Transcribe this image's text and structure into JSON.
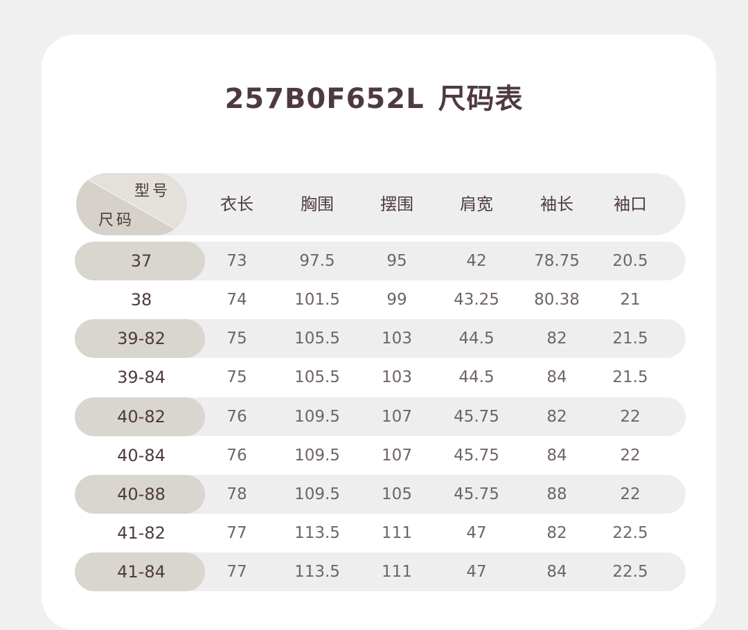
{
  "title": {
    "code": "257B0F652L",
    "label": "尺码表"
  },
  "header": {
    "corner_top": "型号",
    "corner_bottom": "尺码",
    "columns": [
      "衣长",
      "胸围",
      "摆围",
      "肩宽",
      "袖长",
      "袖口"
    ]
  },
  "rows": [
    {
      "size": "37",
      "values": [
        "73",
        "97.5",
        "95",
        "42",
        "78.75",
        "20.5"
      ]
    },
    {
      "size": "38",
      "values": [
        "74",
        "101.5",
        "99",
        "43.25",
        "80.38",
        "21"
      ]
    },
    {
      "size": "39-82",
      "values": [
        "75",
        "105.5",
        "103",
        "44.5",
        "82",
        "21.5"
      ]
    },
    {
      "size": "39-84",
      "values": [
        "75",
        "105.5",
        "103",
        "44.5",
        "84",
        "21.5"
      ]
    },
    {
      "size": "40-82",
      "values": [
        "76",
        "109.5",
        "107",
        "45.75",
        "82",
        "22"
      ]
    },
    {
      "size": "40-84",
      "values": [
        "76",
        "109.5",
        "107",
        "45.75",
        "84",
        "22"
      ]
    },
    {
      "size": "40-88",
      "values": [
        "78",
        "109.5",
        "105",
        "45.75",
        "88",
        "22"
      ]
    },
    {
      "size": "41-82",
      "values": [
        "77",
        "113.5",
        "111",
        "47",
        "82",
        "22.5"
      ]
    },
    {
      "size": "41-84",
      "values": [
        "77",
        "113.5",
        "111",
        "47",
        "84",
        "22.5"
      ]
    }
  ],
  "colors": {
    "text": "#4e3a3e",
    "value_text": "#6e6468",
    "row_stripe": "#eeeeee",
    "size_pill": "#d9d5cf",
    "page_bg": "#f0f0f0"
  }
}
